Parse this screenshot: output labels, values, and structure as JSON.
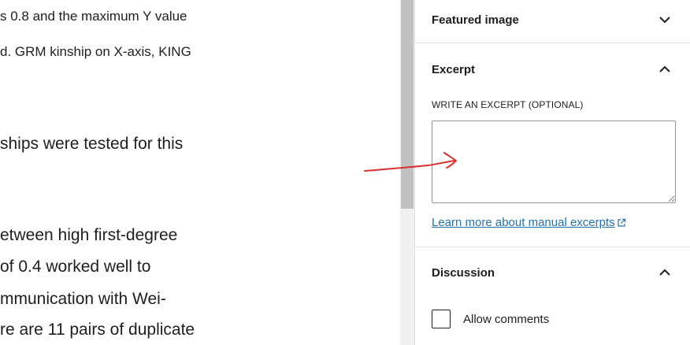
{
  "editor": {
    "lines": [
      "s 0.8 and the maximum Y value",
      "d. GRM kinship on X-axis, KING",
      "ships were tested for this",
      "etween high first-degree",
      "of 0.4 worked well to",
      "mmunication with Wei-",
      "re are 11 pairs of duplicate"
    ]
  },
  "sidebar": {
    "featured_image": {
      "title": "Featured image",
      "state": "collapsed",
      "icon": "chevron-down-icon"
    },
    "excerpt": {
      "title": "Excerpt",
      "state": "expanded",
      "icon": "chevron-up-icon",
      "field_label": "WRITE AN EXCERPT (OPTIONAL)",
      "value": "",
      "learn_more": "Learn more about manual excerpts",
      "learn_more_icon": "external-link-icon"
    },
    "discussion": {
      "title": "Discussion",
      "state": "expanded",
      "icon": "chevron-up-icon",
      "allow_comments_label": "Allow comments",
      "allow_comments_checked": false
    }
  },
  "colors": {
    "link": "#2271b1",
    "annotation": "#d9302c",
    "border": "#e0e0e0"
  }
}
